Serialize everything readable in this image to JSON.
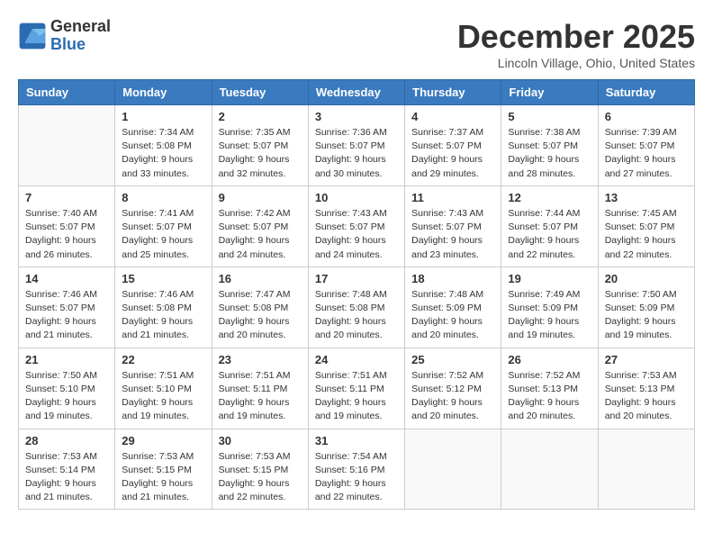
{
  "logo": {
    "general": "General",
    "blue": "Blue"
  },
  "title": "December 2025",
  "location": "Lincoln Village, Ohio, United States",
  "weekdays": [
    "Sunday",
    "Monday",
    "Tuesday",
    "Wednesday",
    "Thursday",
    "Friday",
    "Saturday"
  ],
  "weeks": [
    [
      {
        "day": "",
        "info": ""
      },
      {
        "day": "1",
        "info": "Sunrise: 7:34 AM\nSunset: 5:08 PM\nDaylight: 9 hours\nand 33 minutes."
      },
      {
        "day": "2",
        "info": "Sunrise: 7:35 AM\nSunset: 5:07 PM\nDaylight: 9 hours\nand 32 minutes."
      },
      {
        "day": "3",
        "info": "Sunrise: 7:36 AM\nSunset: 5:07 PM\nDaylight: 9 hours\nand 30 minutes."
      },
      {
        "day": "4",
        "info": "Sunrise: 7:37 AM\nSunset: 5:07 PM\nDaylight: 9 hours\nand 29 minutes."
      },
      {
        "day": "5",
        "info": "Sunrise: 7:38 AM\nSunset: 5:07 PM\nDaylight: 9 hours\nand 28 minutes."
      },
      {
        "day": "6",
        "info": "Sunrise: 7:39 AM\nSunset: 5:07 PM\nDaylight: 9 hours\nand 27 minutes."
      }
    ],
    [
      {
        "day": "7",
        "info": "Sunrise: 7:40 AM\nSunset: 5:07 PM\nDaylight: 9 hours\nand 26 minutes."
      },
      {
        "day": "8",
        "info": "Sunrise: 7:41 AM\nSunset: 5:07 PM\nDaylight: 9 hours\nand 25 minutes."
      },
      {
        "day": "9",
        "info": "Sunrise: 7:42 AM\nSunset: 5:07 PM\nDaylight: 9 hours\nand 24 minutes."
      },
      {
        "day": "10",
        "info": "Sunrise: 7:43 AM\nSunset: 5:07 PM\nDaylight: 9 hours\nand 24 minutes."
      },
      {
        "day": "11",
        "info": "Sunrise: 7:43 AM\nSunset: 5:07 PM\nDaylight: 9 hours\nand 23 minutes."
      },
      {
        "day": "12",
        "info": "Sunrise: 7:44 AM\nSunset: 5:07 PM\nDaylight: 9 hours\nand 22 minutes."
      },
      {
        "day": "13",
        "info": "Sunrise: 7:45 AM\nSunset: 5:07 PM\nDaylight: 9 hours\nand 22 minutes."
      }
    ],
    [
      {
        "day": "14",
        "info": "Sunrise: 7:46 AM\nSunset: 5:07 PM\nDaylight: 9 hours\nand 21 minutes."
      },
      {
        "day": "15",
        "info": "Sunrise: 7:46 AM\nSunset: 5:08 PM\nDaylight: 9 hours\nand 21 minutes."
      },
      {
        "day": "16",
        "info": "Sunrise: 7:47 AM\nSunset: 5:08 PM\nDaylight: 9 hours\nand 20 minutes."
      },
      {
        "day": "17",
        "info": "Sunrise: 7:48 AM\nSunset: 5:08 PM\nDaylight: 9 hours\nand 20 minutes."
      },
      {
        "day": "18",
        "info": "Sunrise: 7:48 AM\nSunset: 5:09 PM\nDaylight: 9 hours\nand 20 minutes."
      },
      {
        "day": "19",
        "info": "Sunrise: 7:49 AM\nSunset: 5:09 PM\nDaylight: 9 hours\nand 19 minutes."
      },
      {
        "day": "20",
        "info": "Sunrise: 7:50 AM\nSunset: 5:09 PM\nDaylight: 9 hours\nand 19 minutes."
      }
    ],
    [
      {
        "day": "21",
        "info": "Sunrise: 7:50 AM\nSunset: 5:10 PM\nDaylight: 9 hours\nand 19 minutes."
      },
      {
        "day": "22",
        "info": "Sunrise: 7:51 AM\nSunset: 5:10 PM\nDaylight: 9 hours\nand 19 minutes."
      },
      {
        "day": "23",
        "info": "Sunrise: 7:51 AM\nSunset: 5:11 PM\nDaylight: 9 hours\nand 19 minutes."
      },
      {
        "day": "24",
        "info": "Sunrise: 7:51 AM\nSunset: 5:11 PM\nDaylight: 9 hours\nand 19 minutes."
      },
      {
        "day": "25",
        "info": "Sunrise: 7:52 AM\nSunset: 5:12 PM\nDaylight: 9 hours\nand 20 minutes."
      },
      {
        "day": "26",
        "info": "Sunrise: 7:52 AM\nSunset: 5:13 PM\nDaylight: 9 hours\nand 20 minutes."
      },
      {
        "day": "27",
        "info": "Sunrise: 7:53 AM\nSunset: 5:13 PM\nDaylight: 9 hours\nand 20 minutes."
      }
    ],
    [
      {
        "day": "28",
        "info": "Sunrise: 7:53 AM\nSunset: 5:14 PM\nDaylight: 9 hours\nand 21 minutes."
      },
      {
        "day": "29",
        "info": "Sunrise: 7:53 AM\nSunset: 5:15 PM\nDaylight: 9 hours\nand 21 minutes."
      },
      {
        "day": "30",
        "info": "Sunrise: 7:53 AM\nSunset: 5:15 PM\nDaylight: 9 hours\nand 22 minutes."
      },
      {
        "day": "31",
        "info": "Sunrise: 7:54 AM\nSunset: 5:16 PM\nDaylight: 9 hours\nand 22 minutes."
      },
      {
        "day": "",
        "info": ""
      },
      {
        "day": "",
        "info": ""
      },
      {
        "day": "",
        "info": ""
      }
    ]
  ]
}
